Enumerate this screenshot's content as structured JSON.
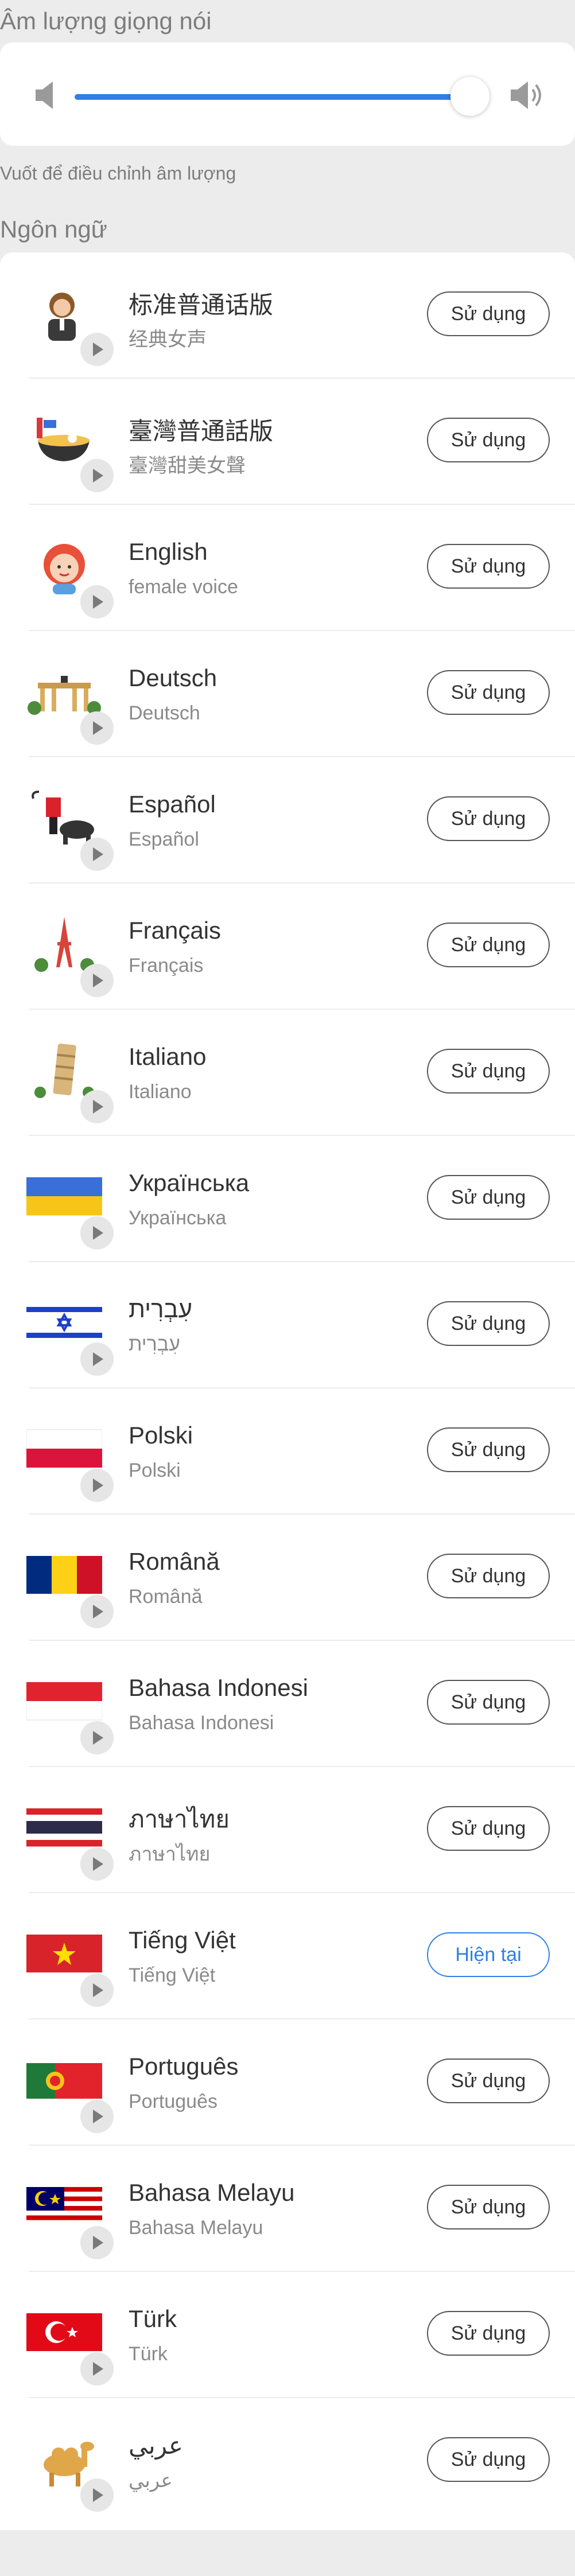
{
  "volume": {
    "title": "Âm lượng giọng nói",
    "level_percent": 97,
    "hint": "Vuốt để điều chỉnh âm lượng"
  },
  "language": {
    "title": "Ngôn ngữ",
    "use_label": "Sử dụng",
    "current_label": "Hiện tại",
    "accent_color": "#2f7fe8",
    "items": [
      {
        "name": "标准普通话版",
        "sub": "经典女声",
        "icon": "female-presenter-icon"
      },
      {
        "name": "臺灣普通話版",
        "sub": "臺灣甜美女聲",
        "icon": "noodle-bowl-icon"
      },
      {
        "name": "English",
        "sub": "female voice",
        "icon": "red-haired-girl-icon"
      },
      {
        "name": "Deutsch",
        "sub": "Deutsch",
        "icon": "brandenburg-gate-icon"
      },
      {
        "name": "Español",
        "sub": "Español",
        "icon": "bullfighter-icon"
      },
      {
        "name": "Français",
        "sub": "Français",
        "icon": "eiffel-tower-icon"
      },
      {
        "name": "Italiano",
        "sub": "Italiano",
        "icon": "leaning-tower-icon"
      },
      {
        "name": "Українська",
        "sub": "Українська",
        "icon": "ukraine-flag-icon"
      },
      {
        "name": "עִבְרִית",
        "sub": "עִבְרִית",
        "icon": "israel-flag-icon"
      },
      {
        "name": "Polski",
        "sub": "Polski",
        "icon": "poland-flag-icon"
      },
      {
        "name": "Română",
        "sub": "Română",
        "icon": "romania-flag-icon"
      },
      {
        "name": "Bahasa Indonesi",
        "sub": "Bahasa Indonesi",
        "icon": "indonesia-flag-icon"
      },
      {
        "name": "ภาษาไทย",
        "sub": "ภาษาไทย",
        "icon": "thailand-flag-icon"
      },
      {
        "name": "Tiếng Việt",
        "sub": "Tiếng Việt",
        "icon": "vietnam-flag-icon",
        "current": true
      },
      {
        "name": "Português",
        "sub": "Português",
        "icon": "portugal-flag-icon"
      },
      {
        "name": "Bahasa Melayu",
        "sub": "Bahasa Melayu",
        "icon": "malaysia-flag-icon"
      },
      {
        "name": "Türk",
        "sub": "Türk",
        "icon": "turkey-flag-icon"
      },
      {
        "name": "عربي",
        "sub": "عربي",
        "icon": "camel-icon"
      }
    ]
  }
}
